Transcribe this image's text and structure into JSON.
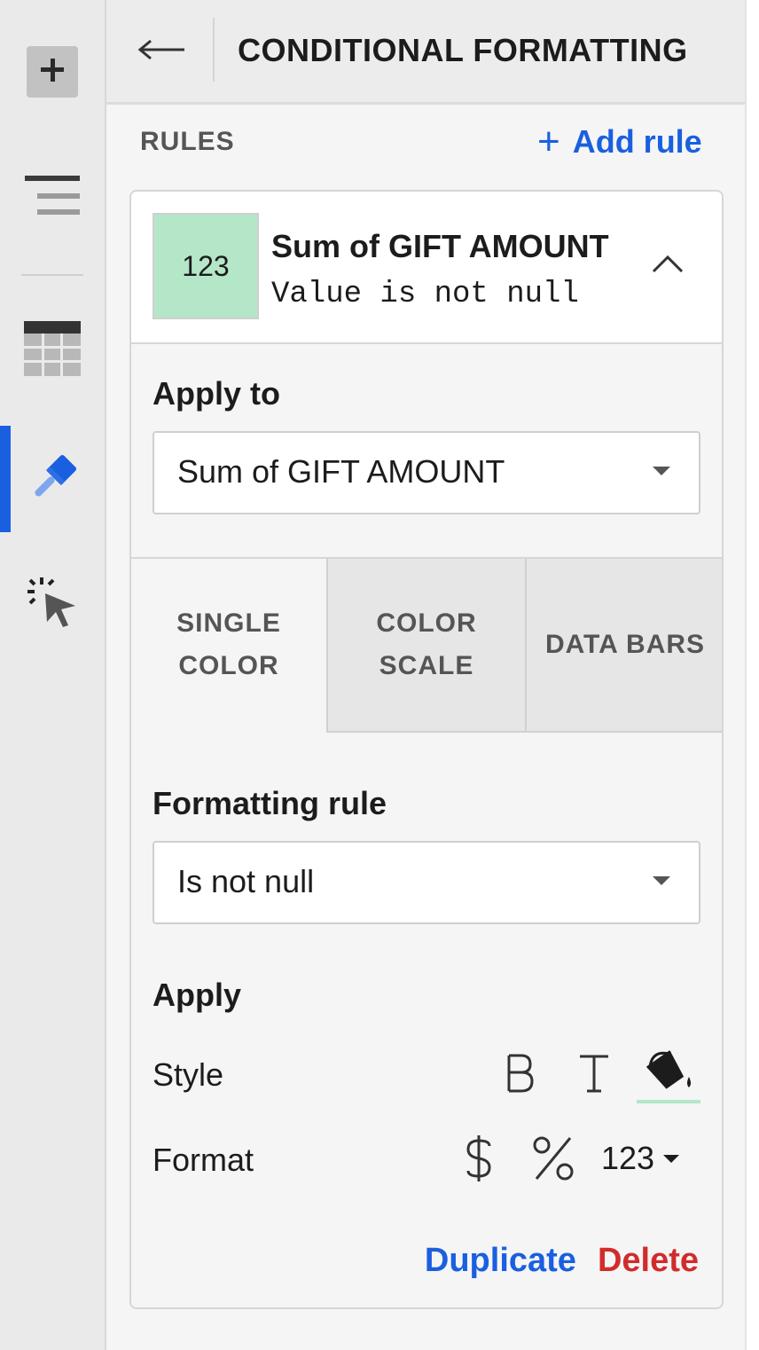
{
  "header": {
    "title": "CONDITIONAL FORMATTING"
  },
  "rules_section": {
    "label": "RULES",
    "add_rule": "Add rule"
  },
  "rule": {
    "swatch_text": "123",
    "swatch_color": "#b4e7c8",
    "title": "Sum of GIFT AMOUNT",
    "description": "Value is not null"
  },
  "apply_to": {
    "label": "Apply to",
    "value": "Sum of GIFT AMOUNT"
  },
  "tabs": [
    {
      "label": "SINGLE COLOR",
      "selected": true
    },
    {
      "label": "COLOR SCALE",
      "selected": false
    },
    {
      "label": "DATA BARS",
      "selected": false
    }
  ],
  "formatting_rule": {
    "label": "Formatting rule",
    "value": "Is not null"
  },
  "apply": {
    "label": "Apply",
    "style_label": "Style",
    "format_label": "Format",
    "number_format": "123"
  },
  "actions": {
    "duplicate": "Duplicate",
    "delete": "Delete"
  },
  "colors": {
    "accent": "#1a5fe0",
    "danger": "#d22b2b",
    "fill": "#b4e7c8"
  },
  "icons": [
    "plus-icon",
    "align-left-icon",
    "table-icon",
    "paintbrush-icon",
    "cursor-click-icon",
    "arrow-left-icon",
    "chevron-up-icon",
    "bold-icon",
    "text-color-icon",
    "fill-color-icon",
    "currency-icon",
    "percent-icon"
  ]
}
